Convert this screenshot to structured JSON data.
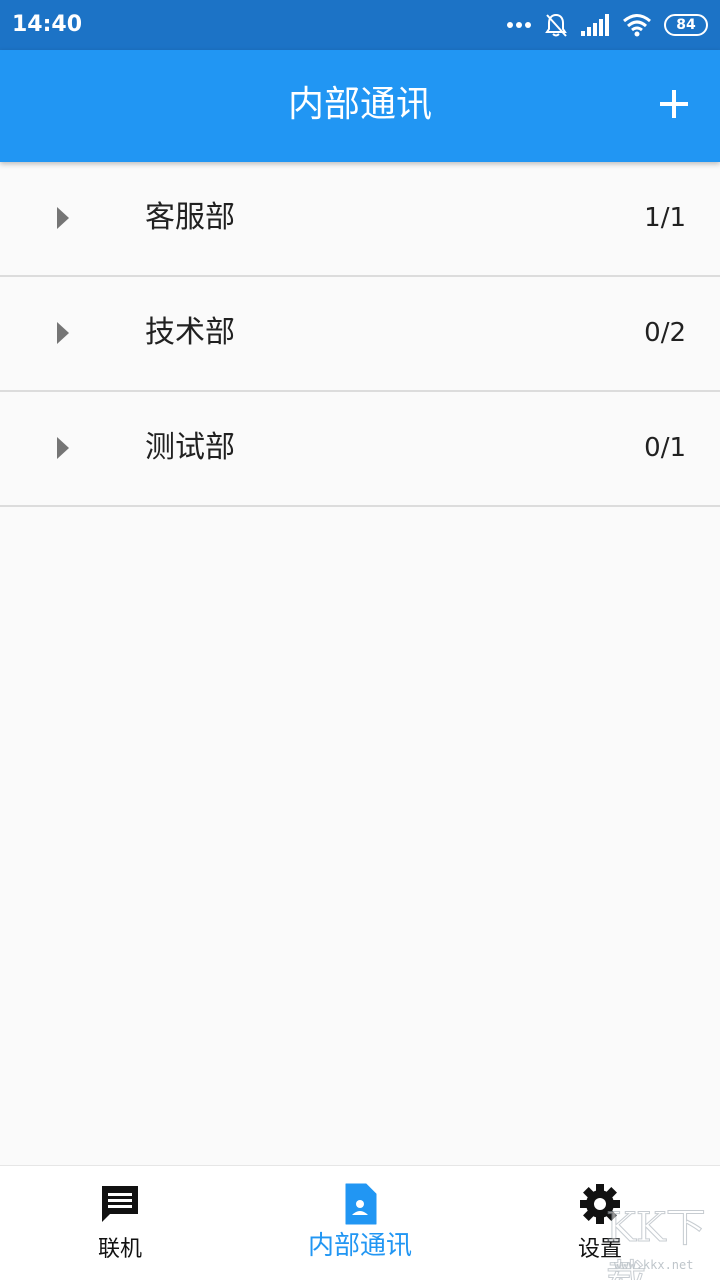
{
  "status_bar": {
    "time": "14:40",
    "battery": "84",
    "icons": [
      "more-dots-icon",
      "bell-off-icon",
      "signal-icon",
      "wifi-icon",
      "battery-icon"
    ]
  },
  "app_bar": {
    "title": "内部通讯",
    "add_icon": "plus-icon"
  },
  "departments": [
    {
      "name": "客服部",
      "count": "1/1"
    },
    {
      "name": "技术部",
      "count": "0/2"
    },
    {
      "name": "测试部",
      "count": "0/1"
    }
  ],
  "bottom_nav": {
    "items": [
      {
        "label": "联机",
        "icon": "chat-icon",
        "active": false
      },
      {
        "label": "内部通讯",
        "icon": "contact-card-icon",
        "active": true
      },
      {
        "label": "设置",
        "icon": "gear-icon",
        "active": false
      }
    ]
  },
  "watermark": {
    "text": "KK下载",
    "url": "www.kkx.net"
  },
  "colors": {
    "primary": "#2196f3",
    "status_bar": "#1c73c6",
    "background": "#fafafa",
    "divider": "#dcdcdc"
  }
}
